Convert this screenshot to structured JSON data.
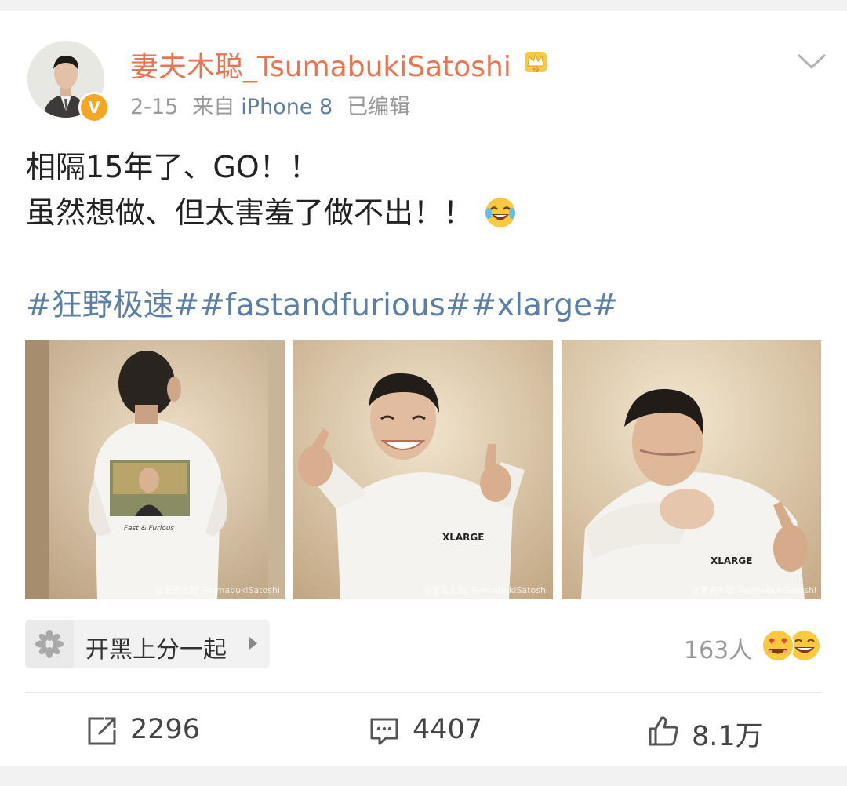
{
  "post": {
    "username": "妻夫木聪_TsumabukiSatoshi",
    "date": "2-15",
    "source_prefix": "来自",
    "source": "iPhone 8",
    "edited": "已编辑",
    "text_line1": "相隔15年了、GO！！",
    "text_line2": "虽然想做、但太害羞了做不出！！",
    "hashtags": [
      "#狂野极速#",
      "#fastandfurious#",
      "#xlarge#"
    ],
    "badge": "V",
    "icons": {
      "verified": "verified-v-icon",
      "member": "crown-icon",
      "menu": "chevron-down-icon",
      "emoji": "laughing-tears-emoji-icon"
    }
  },
  "photos": [
    {
      "watermark": "@妻夫木聪_TsumabukiSatoshi",
      "shirt_print": "Fast & Furious"
    },
    {
      "watermark": "@妻夫木聪_TsumabukiSatoshi",
      "shirt_print": "XLARGE"
    },
    {
      "watermark": "@妻夫木聪_TsumabukiSatoshi",
      "shirt_print": "XLARGE"
    }
  ],
  "location_chip": {
    "label": "开黑上分一起",
    "icon": "flower-icon"
  },
  "reactions": {
    "count_label": "163人",
    "icons": [
      "heart-eyes-emoji-icon",
      "grin-emoji-icon"
    ]
  },
  "actions": {
    "repost": {
      "count": "2296",
      "icon": "repost-icon"
    },
    "comment": {
      "count": "4407",
      "icon": "comment-icon"
    },
    "like": {
      "count": "8.1万",
      "icon": "thumbs-up-icon"
    }
  },
  "colors": {
    "username": "#eb7350",
    "link": "#5b7fa6",
    "meta": "#999999",
    "badge": "#f5a623"
  }
}
